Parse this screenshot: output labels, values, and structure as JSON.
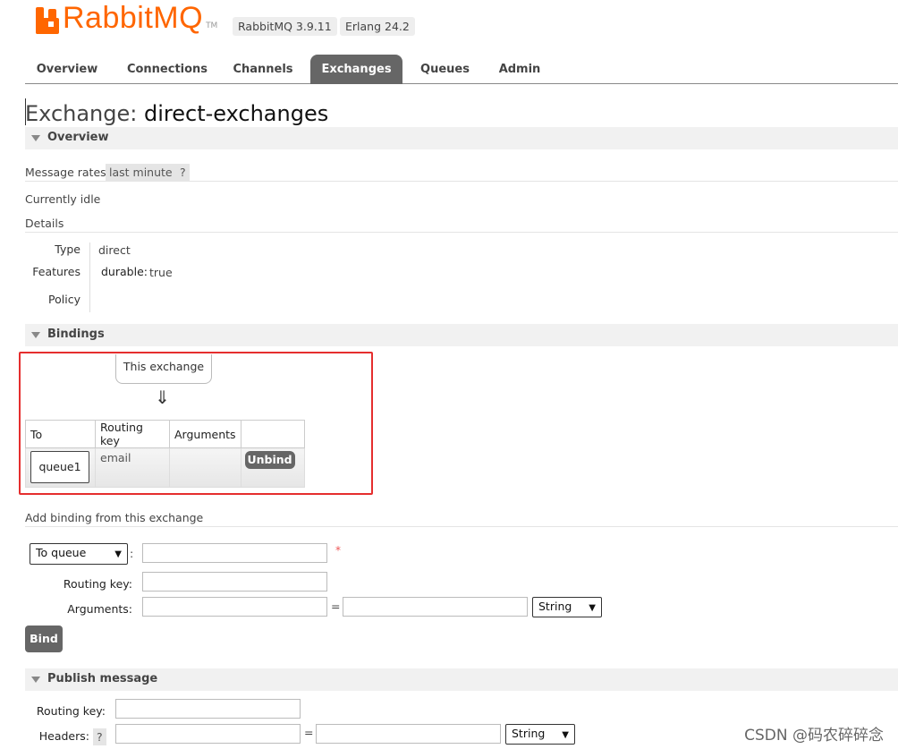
{
  "header": {
    "logo_text": "RabbitMQ",
    "logo_tm": "TM",
    "version_badge": "RabbitMQ 3.9.11",
    "erlang_badge": "Erlang 24.2",
    "brand_color": "#ff6600"
  },
  "tabs": [
    {
      "label": "Overview"
    },
    {
      "label": "Connections"
    },
    {
      "label": "Channels"
    },
    {
      "label": "Exchanges",
      "active": true
    },
    {
      "label": "Queues"
    },
    {
      "label": "Admin"
    }
  ],
  "page": {
    "title_prefix": "Exchange:",
    "title_name": "direct-exchanges"
  },
  "overview": {
    "section_label": "Overview",
    "message_rates_label": "Message rates",
    "message_rates_range": "last minute",
    "help": "?",
    "idle_text": "Currently idle",
    "details_label": "Details",
    "type_label": "Type",
    "type_value": "direct",
    "features_label": "Features",
    "durable_key": "durable:",
    "durable_value": "true",
    "policy_label": "Policy"
  },
  "bindings": {
    "section_label": "Bindings",
    "this_exchange": "This exchange",
    "arrow": "⇓",
    "columns": [
      "To",
      "Routing key",
      "Arguments",
      ""
    ],
    "rows": [
      {
        "to": "queue1",
        "routing_key": "email",
        "arguments": "",
        "action": "Unbind"
      }
    ],
    "highlight_color": "#e52e2e"
  },
  "add_binding": {
    "heading": "Add binding from this exchange",
    "destination_select": "To queue",
    "colon": ":",
    "required_mark": "*",
    "routing_key_label": "Routing key:",
    "arguments_label": "Arguments:",
    "equals": "=",
    "type_select": "String",
    "bind_button": "Bind"
  },
  "publish": {
    "section_label": "Publish message",
    "routing_key_label": "Routing key:",
    "headers_label": "Headers:",
    "help": "?",
    "equals": "=",
    "type_select": "String"
  },
  "watermark": "CSDN @码农碎碎念"
}
